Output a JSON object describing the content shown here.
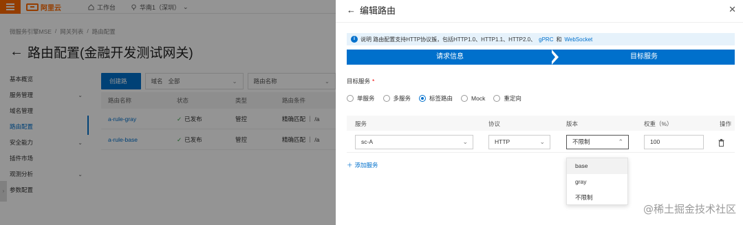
{
  "left": {
    "topbar": {
      "logo_text": "阿里云",
      "workbench": "工作台",
      "region": "华南1（深圳）"
    },
    "breadcrumb": [
      "微服务引擎MSE",
      "/",
      "网关列表",
      "/",
      "路由配置"
    ],
    "page_title": "路由配置(金融开发测试网关)",
    "sidebar": [
      {
        "label": "基本概览",
        "chev": ""
      },
      {
        "label": "服务管理",
        "chev": "⌄"
      },
      {
        "label": "域名管理",
        "chev": ""
      },
      {
        "label": "路由配置",
        "chev": ""
      },
      {
        "label": "安全能力",
        "chev": "⌄"
      },
      {
        "label": "插件市场",
        "chev": ""
      },
      {
        "label": "观测分析",
        "chev": "⌄"
      },
      {
        "label": "参数配置",
        "chev": ""
      }
    ],
    "toolbar": {
      "create_label": "创建路由",
      "domain_label": "域名",
      "domain_value": "全部",
      "name_label": "路由名称"
    },
    "table": {
      "headers": [
        "路由名称",
        "状态",
        "类型",
        "路由条件"
      ],
      "rows": [
        {
          "name": "a-rule-gray",
          "status": "已发布",
          "type": "管控",
          "cond": "精确匹配 ｜ /a"
        },
        {
          "name": "a-rule-base",
          "status": "已发布",
          "type": "管控",
          "cond": "精确匹配 ｜ /a"
        }
      ]
    }
  },
  "drawer": {
    "title": "编辑路由",
    "notice": {
      "prefix": "说明 路由配置支持HTTP协议簇，包括HTTP1.0、HTTP1.1、HTTP2.0、",
      "link1": "gPRC",
      "mid": "和",
      "link2": "WebSocket"
    },
    "steps": [
      "请求信息",
      "目标服务"
    ],
    "target_label": "目标服务",
    "required_mark": "*",
    "radios": [
      {
        "label": "单服务",
        "checked": false
      },
      {
        "label": "多服务",
        "checked": false
      },
      {
        "label": "标签路由",
        "checked": true
      },
      {
        "label": "Mock",
        "checked": false
      },
      {
        "label": "重定向",
        "checked": false
      }
    ],
    "svc_headers": {
      "service": "服务",
      "protocol": "协议",
      "version": "版本",
      "weight": "权重（%）",
      "action": "操作"
    },
    "svc_row": {
      "service": "sc-A",
      "protocol": "HTTP",
      "version": "不限制",
      "weight": "100"
    },
    "add_service": "添加服务",
    "version_options": [
      "base",
      "gray",
      "不限制"
    ]
  },
  "watermark": "@稀土掘金技术社区"
}
